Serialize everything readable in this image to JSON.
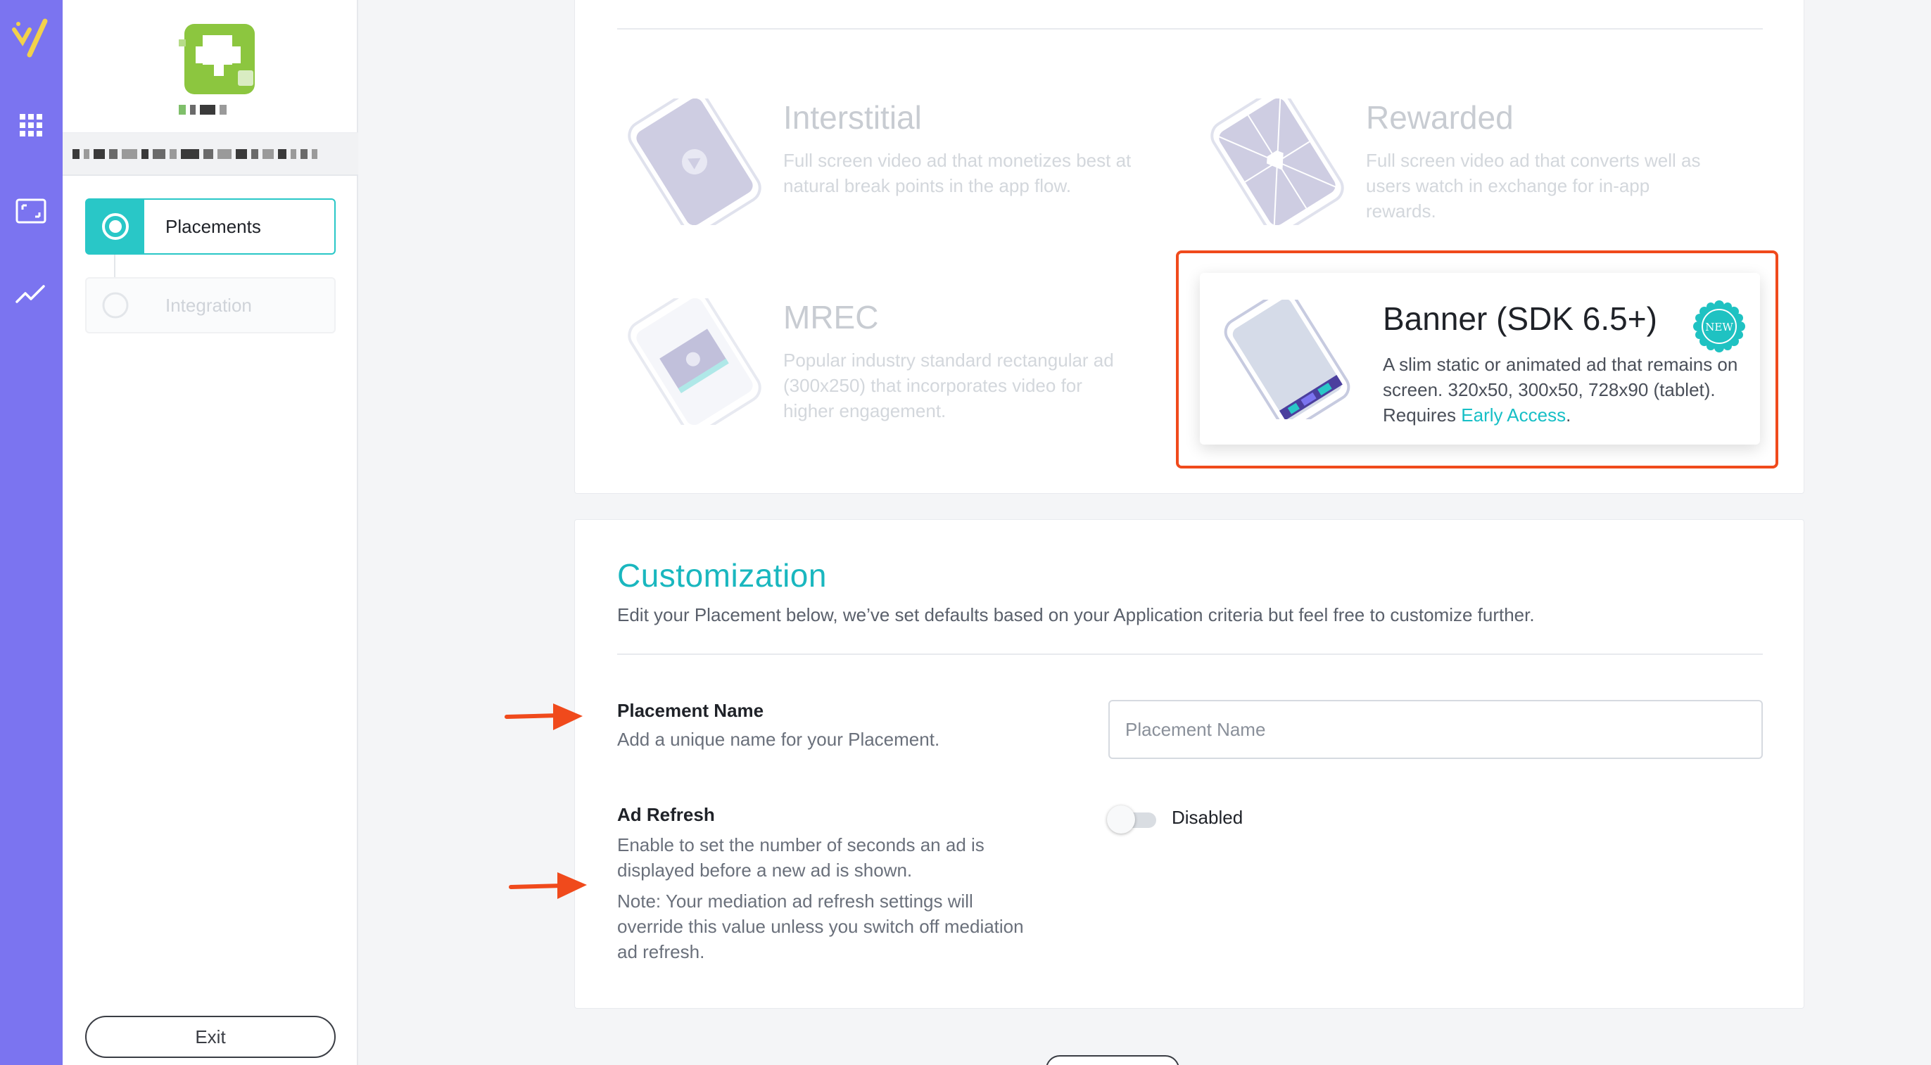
{
  "sidebar": {
    "steps": [
      {
        "label": "Placements",
        "state": "active"
      },
      {
        "label": "Integration",
        "state": "inactive"
      }
    ],
    "exit_label": "Exit"
  },
  "ad_types": {
    "interstitial": {
      "title": "Interstitial",
      "description": "Full screen video ad that monetizes best at natural break points in the app flow."
    },
    "rewarded": {
      "title": "Rewarded",
      "description": "Full screen video ad that converts well as users watch in exchange for in-app rewards."
    },
    "mrec": {
      "title": "MREC",
      "description": "Popular industry standard rectangular ad (300x250) that incorporates video for higher engagement."
    },
    "banner": {
      "title": "Banner (SDK 6.5+)",
      "description_prefix": "A slim static or animated ad that remains on screen. 320x50, 300x50, 728x90 (tablet). Requires ",
      "early_access_link": "Early Access",
      "description_suffix": ".",
      "badge": "NEW",
      "selected": true
    }
  },
  "customization": {
    "title": "Customization",
    "subtitle": "Edit your Placement below, we’ve set defaults based on your Application criteria but feel free to customize further.",
    "placement_name": {
      "label": "Placement Name",
      "help": "Add a unique name for your Placement.",
      "placeholder": "Placement Name",
      "value": ""
    },
    "ad_refresh": {
      "label": "Ad Refresh",
      "help": "Enable to set the number of seconds an ad is displayed before a new ad is shown.",
      "note": "Note: Your mediation ad refresh settings will override this value unless you switch off mediation ad refresh.",
      "toggle_state": "Disabled",
      "enabled": false
    }
  },
  "colors": {
    "rail": "#7b74f0",
    "accent": "#29c7c7",
    "title_teal": "#1ab7bf",
    "highlight": "#f04a1c"
  }
}
